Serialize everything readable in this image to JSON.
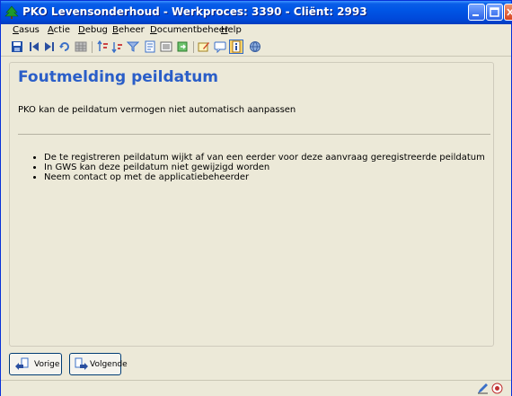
{
  "window": {
    "title": "PKO Levensonderhoud - Werkproces: 3390 - Cliënt: 2993"
  },
  "menu": {
    "items": [
      "Casus",
      "Actie",
      "Debug",
      "Beheer",
      "Documentbeheer",
      "Help"
    ]
  },
  "content": {
    "title": "Foutmelding peildatum",
    "message": "PKO kan de peildatum vermogen niet automatisch aanpassen",
    "bullets": [
      "De te registreren peildatum wijkt af van een eerder voor deze aanvraag geregistreerde peildatum",
      "In GWS kan deze peildatum niet gewijzigd worden",
      "Neem contact op met de applicatiebeheerder"
    ]
  },
  "navigation": {
    "prev_label": "Vorige",
    "next_label": "Volgende"
  },
  "colors": {
    "accent": "#2a5ec8",
    "titlebar": "#0055e5"
  }
}
